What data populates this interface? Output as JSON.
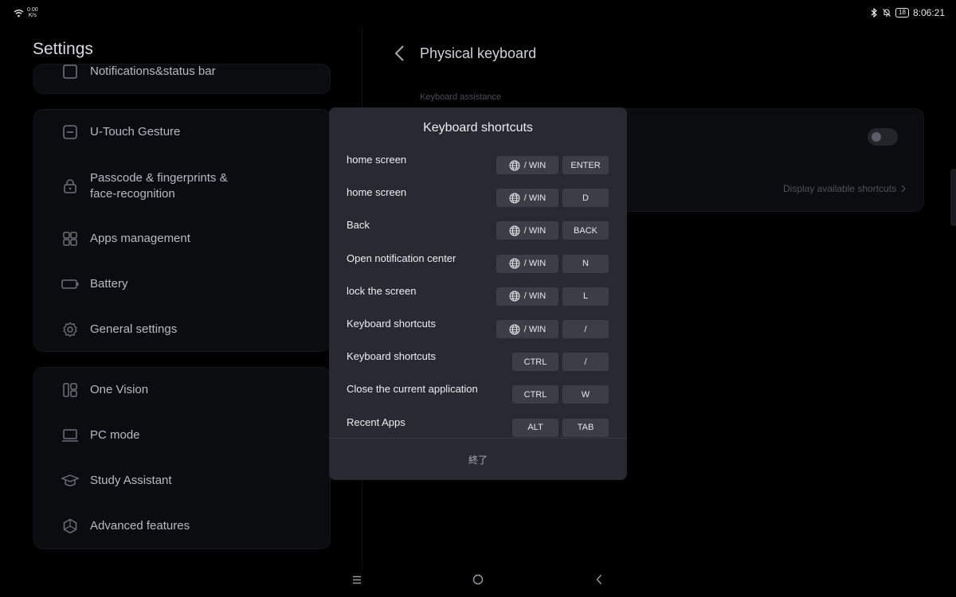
{
  "status_bar": {
    "speed_value": "0.00",
    "speed_unit": "K/s",
    "battery": "18",
    "time": "8:06:21"
  },
  "settings": {
    "title": "Settings",
    "card1_partial_item": "Notifications&status bar",
    "card2_items": [
      {
        "label": "U-Touch Gesture",
        "icon": "touch-gesture-icon"
      },
      {
        "label": "Passcode & fingerprints &\nface-recognition",
        "icon": "lock-icon"
      },
      {
        "label": "Apps management",
        "icon": "apps-grid-icon"
      },
      {
        "label": "Battery",
        "icon": "battery-icon"
      },
      {
        "label": "General settings",
        "icon": "gear-icon"
      }
    ],
    "card3_items": [
      {
        "label": "One Vision",
        "icon": "one-vision-icon"
      },
      {
        "label": "PC mode",
        "icon": "laptop-icon"
      },
      {
        "label": "Study Assistant",
        "icon": "graduation-cap-icon"
      },
      {
        "label": "Advanced features",
        "icon": "hexagon-icon"
      }
    ]
  },
  "physical_keyboard": {
    "title": "Physical keyboard",
    "section_caption": "Keyboard assistance",
    "display_shortcuts_link": "Display available shortcuts"
  },
  "shortcuts_dialog": {
    "title": "Keyboard shortcuts",
    "rows": [
      {
        "label": "home screen",
        "modifier": "/ WIN",
        "modifier_has_globe": true,
        "key": "ENTER"
      },
      {
        "label": "home screen",
        "modifier": "/ WIN",
        "modifier_has_globe": true,
        "key": "D"
      },
      {
        "label": "Back",
        "modifier": "/ WIN",
        "modifier_has_globe": true,
        "key": "BACK"
      },
      {
        "label": "Open notification center",
        "modifier": "/ WIN",
        "modifier_has_globe": true,
        "key": "N"
      },
      {
        "label": "lock the screen",
        "modifier": "/ WIN",
        "modifier_has_globe": true,
        "key": "L"
      },
      {
        "label": "Keyboard shortcuts",
        "modifier": "/ WIN",
        "modifier_has_globe": true,
        "key": "/"
      },
      {
        "label": "Keyboard shortcuts",
        "modifier": "CTRL",
        "modifier_has_globe": false,
        "key": "/"
      },
      {
        "label": "Close the current application",
        "modifier": "CTRL",
        "modifier_has_globe": false,
        "key": "W"
      },
      {
        "label": "Recent Apps",
        "modifier": "ALT",
        "modifier_has_globe": false,
        "key": "TAB"
      }
    ],
    "done_label": "終了"
  },
  "colors": {
    "background": "#000000",
    "card": "#0b0c10",
    "dialog": "#282a31",
    "key": "#3c3e47"
  }
}
